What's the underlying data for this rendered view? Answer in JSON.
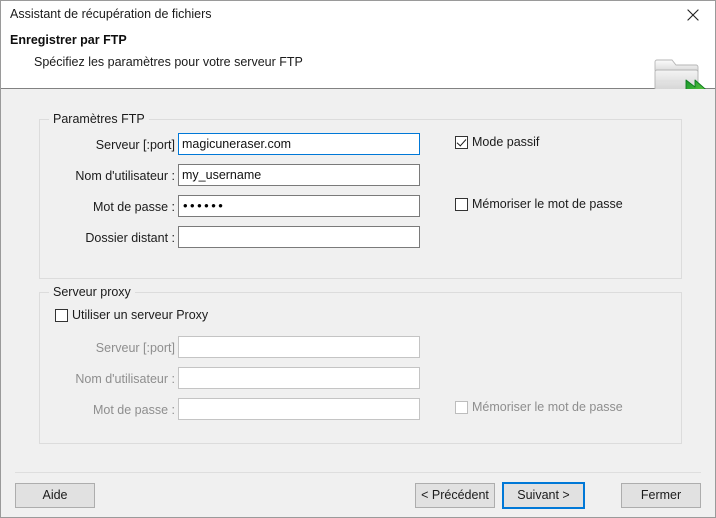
{
  "window": {
    "title": "Assistant de récupération de fichiers",
    "close_icon": "close-icon"
  },
  "header": {
    "title": "Enregistrer par FTP",
    "subtitle": "Spécifiez les paramètres pour votre serveur FTP",
    "icon": "folder-upload-icon"
  },
  "ftp_group": {
    "legend": "Paramètres FTP",
    "fields": [
      {
        "label": "Serveur [:port]",
        "value": "magicuneraser.com",
        "focused": true
      },
      {
        "label": "Nom d'utilisateur :",
        "value": "my_username",
        "focused": false
      },
      {
        "label": "Mot de passe :",
        "value": "••••••",
        "focused": false
      },
      {
        "label": "Dossier distant :",
        "value": "",
        "focused": false
      }
    ],
    "checkboxes": [
      {
        "label": "Mode passif",
        "checked": true
      },
      {
        "label": "Mémoriser le mot de passe",
        "checked": false
      }
    ]
  },
  "proxy_group": {
    "legend": "Serveur proxy",
    "enable_checkbox": {
      "label": "Utiliser un serveur Proxy",
      "checked": false
    },
    "fields": [
      {
        "label": "Serveur [:port]",
        "value": ""
      },
      {
        "label": "Nom d'utilisateur :",
        "value": ""
      },
      {
        "label": "Mot de passe :",
        "value": ""
      }
    ],
    "remember_checkbox": {
      "label": "Mémoriser le mot de passe",
      "checked": false
    }
  },
  "footer": {
    "help_label": "Aide",
    "previous_label": "< Précédent",
    "next_label": "Suivant >",
    "close_label": "Fermer"
  },
  "colors": {
    "accent": "#0078d7",
    "content_bg": "#f0f0f0",
    "window_bg": "#ffffff",
    "button_bg": "#e1e1e1",
    "disabled_text": "#8e8e8e"
  }
}
